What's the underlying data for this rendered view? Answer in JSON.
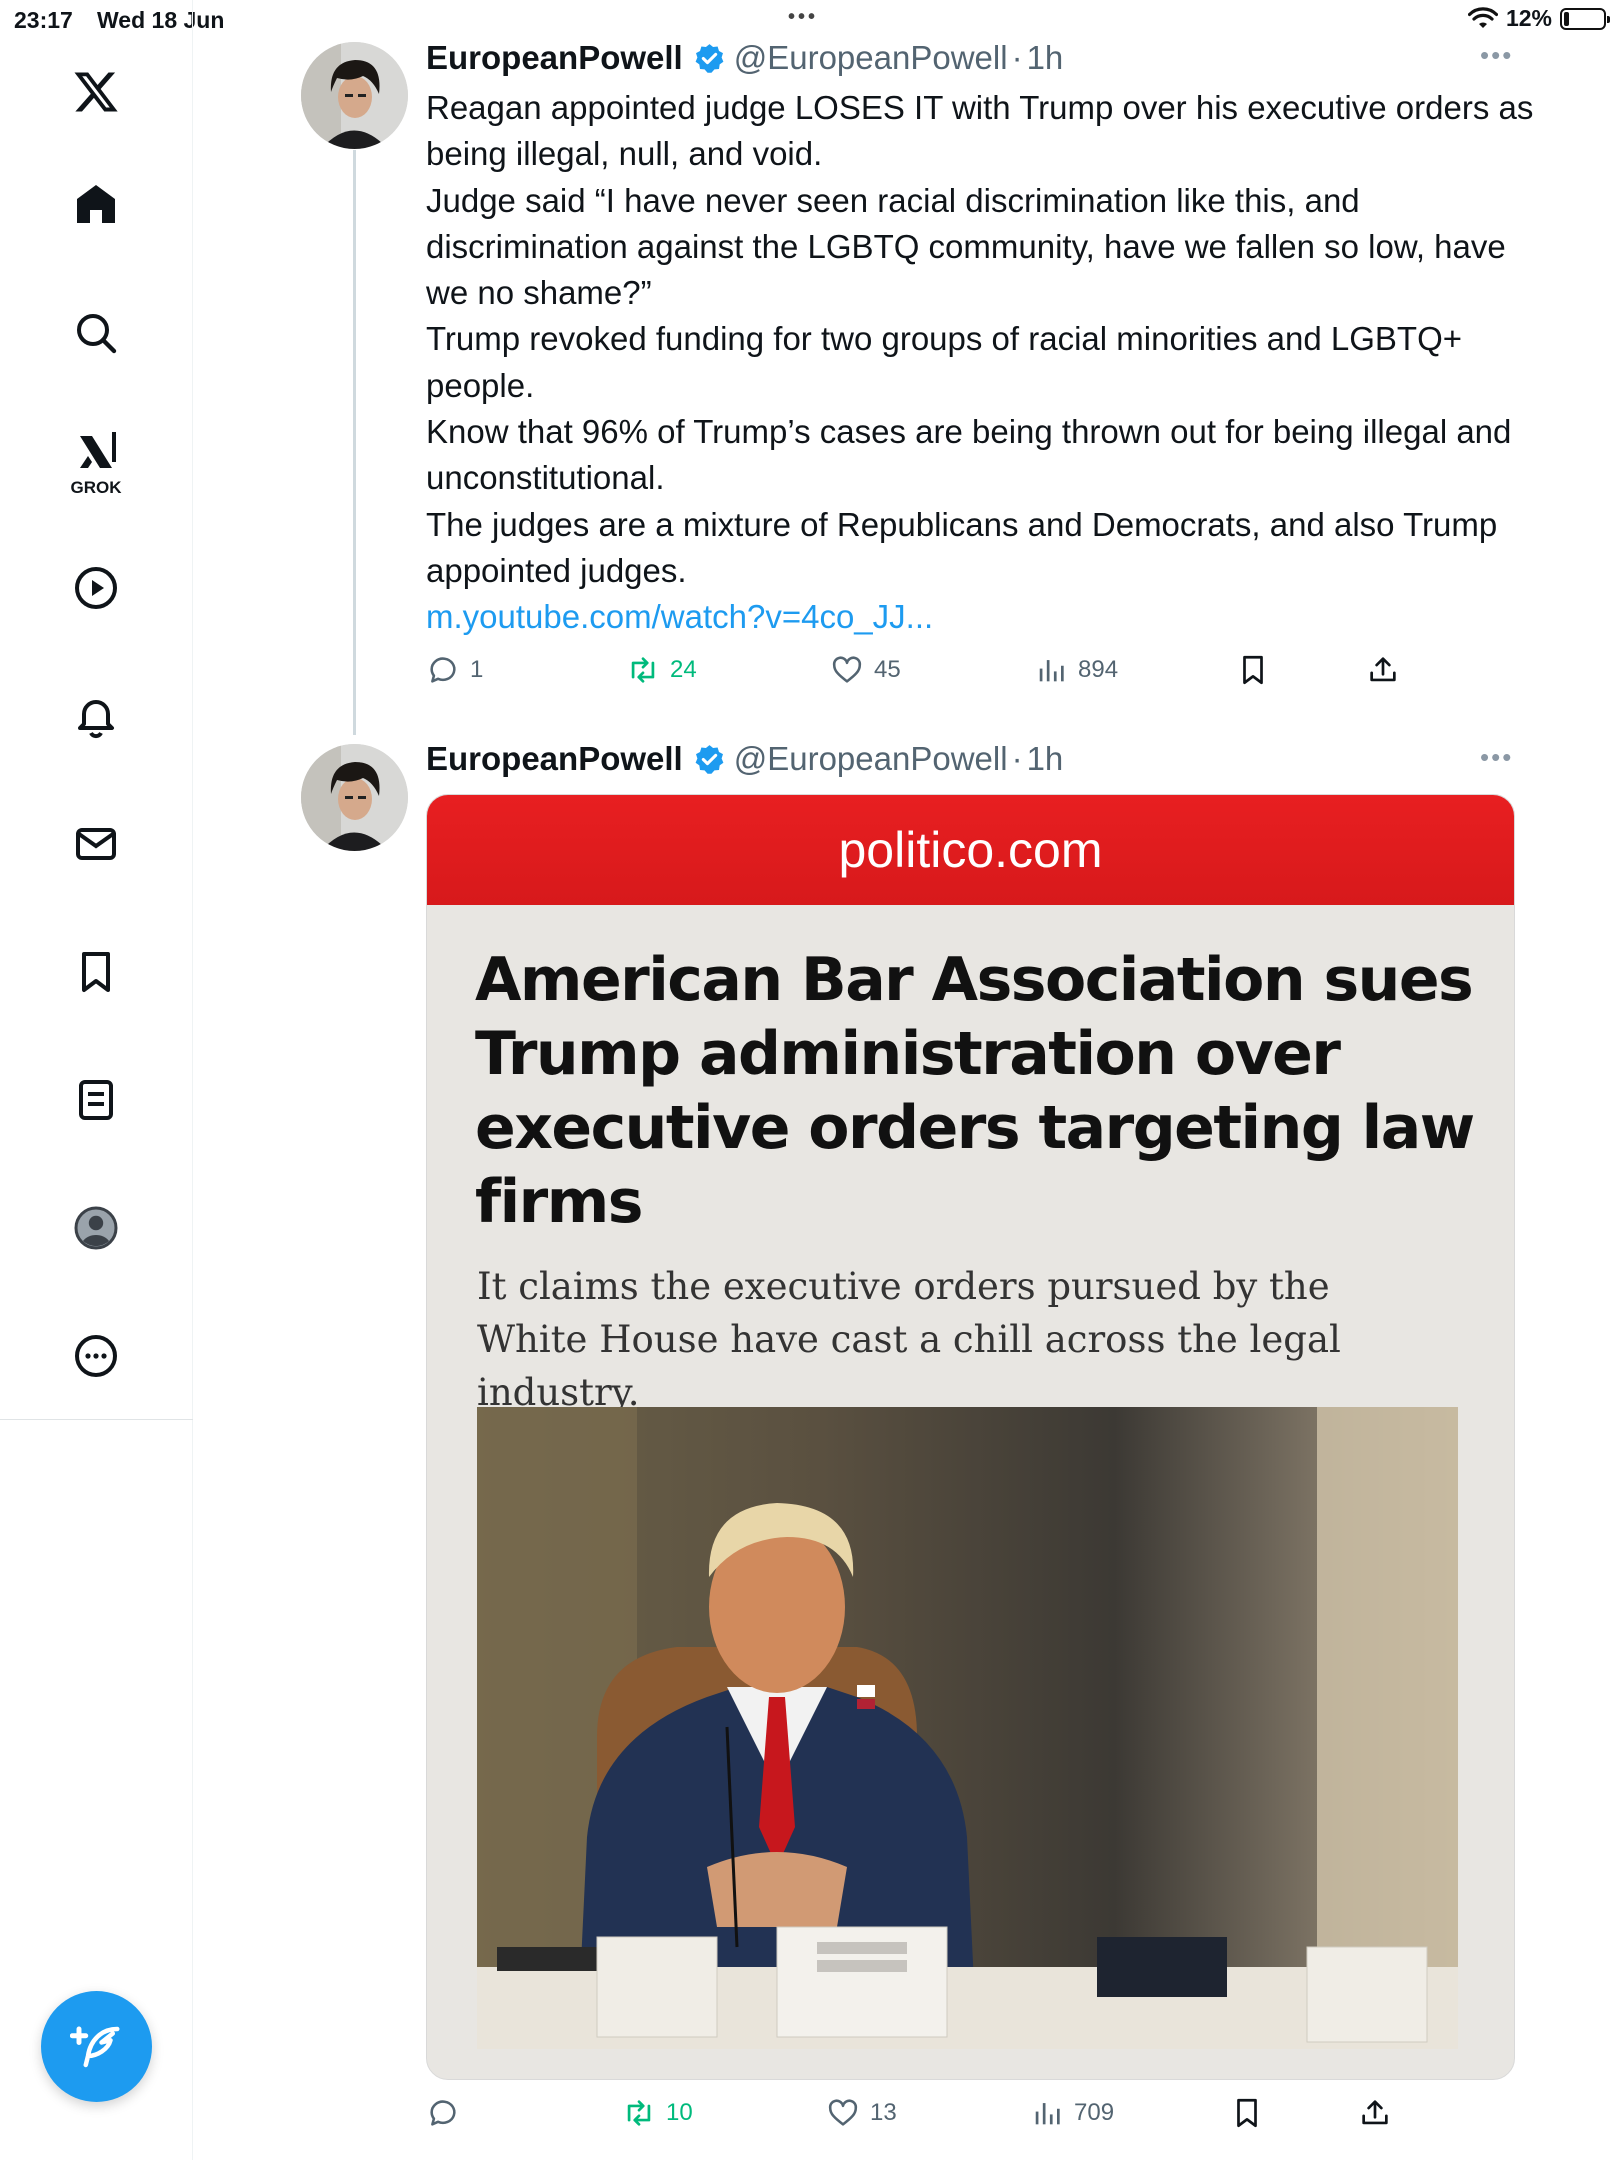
{
  "status_bar": {
    "time": "23:17",
    "date": "Wed 18 Jun",
    "battery": "12%",
    "battery_level": 0.12
  },
  "sidebar": {
    "items": [
      {
        "name": "x-logo",
        "label": "X"
      },
      {
        "name": "home",
        "label": "Home"
      },
      {
        "name": "search",
        "label": "Search"
      },
      {
        "name": "grok",
        "label": "GROK"
      },
      {
        "name": "video",
        "label": "Video"
      },
      {
        "name": "notifications",
        "label": "Notifications"
      },
      {
        "name": "messages",
        "label": "Messages"
      },
      {
        "name": "bookmarks",
        "label": "Bookmarks"
      },
      {
        "name": "lists",
        "label": "Lists"
      },
      {
        "name": "profile",
        "label": "Profile"
      },
      {
        "name": "more",
        "label": "More"
      }
    ],
    "grok_label": "GROK"
  },
  "tweets": [
    {
      "author": "EuropeanPowell",
      "handle": "@EuropeanPowell",
      "separator": "·",
      "time": "1h",
      "text_lines": [
        "Reagan appointed judge LOSES IT with Trump over his executive orders as being illegal, null, and void.",
        "Judge said “I have never seen racial discrimination like this, and discrimination against the LGBTQ community, have we fallen so low, have we no shame?”",
        "Trump revoked funding for two groups of racial minorities and LGBTQ+ people.",
        "Know that 96% of Trump’s cases are being thrown out for being illegal and unconstitutional.",
        "The judges are a mixture of Republicans and Democrats, and also Trump appointed judges."
      ],
      "link": "m.youtube.com/watch?v=4co_JJ...",
      "replies": "1",
      "retweets": "24",
      "likes": "45",
      "views": "894"
    },
    {
      "author": "EuropeanPowell",
      "handle": "@EuropeanPowell",
      "separator": "·",
      "time": "1h",
      "media": {
        "site": "politico.com",
        "headline": "American Bar Association sues Trump administration over executive orders targeting law firms",
        "subhead": "It claims the executive orders pursued by the White House have cast a chill across the legal industry."
      },
      "replies": "",
      "retweets": "10",
      "likes": "13",
      "views": "709"
    }
  ],
  "colors": {
    "accent": "#1d9bf0",
    "retweet": "#00ba7c",
    "secondary_text": "#536471",
    "politico_red": "#e81f21"
  }
}
